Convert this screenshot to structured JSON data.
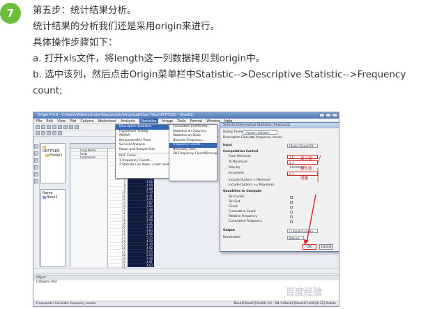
{
  "step": {
    "number": "7",
    "lines": [
      "第五步：统计结果分析。",
      "统计结果的分析我们还是采用origin来进行。",
      "具体操作步骤如下：",
      "a. 打开xls文件，将length这一列数据拷贝到origin中。",
      "b. 选中该列，然后点击Origin菜单栏中Statistic-->Descriptive Statistic-->Frequency",
      "count;"
    ]
  },
  "screenshot": {
    "window_title": "Origin Pro 8 - C:\\Users\\Administrator\\Documents\\OriginLab\\User Files\\UNTITLED - [Book1]",
    "menus": [
      "File",
      "Edit",
      "View",
      "Plot",
      "Column",
      "Worksheet",
      "Analysis",
      "Statistics",
      "Image",
      "Tools",
      "Format",
      "Window",
      "Help"
    ],
    "highlighted_menu": "Statistics",
    "explorer": {
      "project": "UNTITLED",
      "folder": "Folder1",
      "items_header": "Name",
      "book": "Book1"
    },
    "sheet": {
      "col_labels": [
        "Long Name",
        "Units",
        "Comments"
      ],
      "col_a_values": [
        "1",
        "2",
        "3",
        "4",
        "5",
        "6",
        "7",
        "8",
        "9",
        "10",
        "11",
        "12",
        "13",
        "14",
        "15",
        "16",
        "17",
        "18",
        "19",
        "20",
        "21",
        "22",
        "23",
        "24",
        "25",
        "26",
        "27",
        "28",
        "29",
        "30",
        "31",
        "32"
      ],
      "col_b_values": [
        "4.50",
        "4.21",
        "5.03",
        "3.98",
        "4.77",
        "5.12",
        "4.66",
        "4.09",
        "4.88",
        "5.30",
        "4.41",
        "4.95",
        "3.87",
        "4.62",
        "5.08",
        "4.73",
        "4.18",
        "4.99",
        "5.21",
        "4.37",
        "4.84",
        "4.56",
        "5.15",
        "4.29",
        "4.70",
        "4.92",
        "4.05",
        "5.04",
        "4.48",
        "4.81",
        "4.63",
        "5.26"
      ]
    },
    "statistics_menu": [
      "Descriptive Statistics",
      "Hypothesis Testing",
      "ANOVA",
      "Nonparametric Tests",
      "Survival Analysis",
      "Power and Sample Size",
      "ROC Curve...",
      "1 Frequency Counts...",
      "2 Statistics on Rows: <Last used>"
    ],
    "descriptive_submenu": [
      "Correlation Coefficient...",
      "Statistics on Columns",
      "Statistics on Rows",
      "Discrete Frequency...",
      "Frequency Counts...",
      "Normality Test...",
      "2D Frequency Count/Binning..."
    ],
    "dialog": {
      "title": "Statistics\\Descriptive Statistics: freqcounts",
      "dialog_theme_label": "Dialog Theme",
      "theme_value": "<factory default>",
      "description": "Description  Calculate frequency counts",
      "input_label": "Input",
      "input_value": "[Book1]Sheet1!B",
      "computation_control": "Computation Control",
      "from_minimum": "From Minimum",
      "to_maximum": "To Maximum",
      "step_by": "Step by",
      "increment": "Increment",
      "from_value": "3.8",
      "to_value": "5.4",
      "step_option": "Increment",
      "increment_value": "0.1",
      "include_outliers_min": "Include Outliers < Minimum",
      "include_outliers_max": "Include Outliers >= Maximum",
      "quantities": "Quantities to Compute",
      "q_items": [
        "Bin Center",
        "Bin End",
        "Count",
        "Cumulative Count",
        "Relative Frequency",
        "Cumulative Frequency"
      ],
      "output_label": "Output",
      "output_value": "[<input>]<new>",
      "recalculate_label": "Recalculate",
      "recalculate_value": "Manual",
      "ok": "OK",
      "cancel": "Cancel"
    },
    "annotations": [
      "最小值",
      "最大值",
      "增量"
    ],
    "command_window_title": "Object",
    "command_columns": "Category  Text",
    "status_text": "Freqcounts: Calculate frequency counts",
    "status_right": "Book1[Sheet1]!Col(B)   AU : ON   1:[Book1]Sheet1!Col(B)[1:32]   Radian",
    "watermark": "百度经验"
  }
}
